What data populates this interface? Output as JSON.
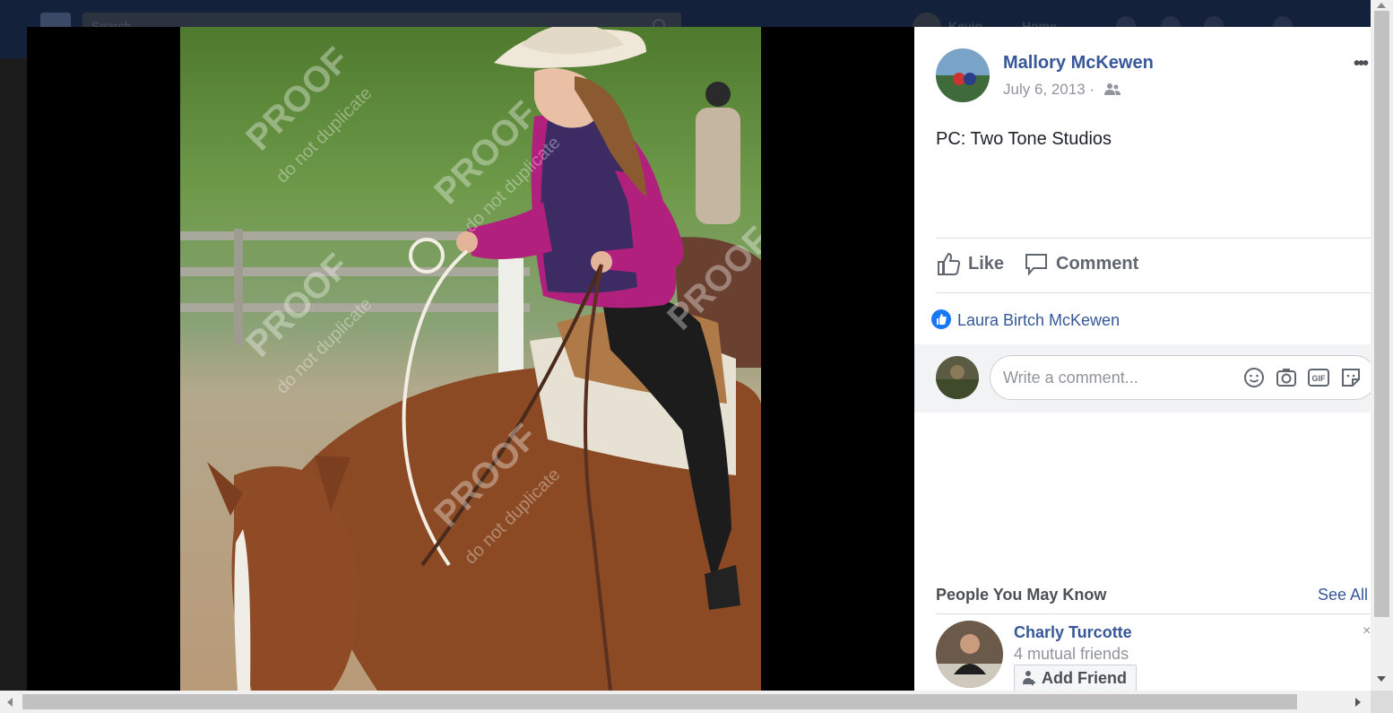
{
  "topbar": {
    "search_placeholder": "Search",
    "user_name": "Kevin",
    "home_label": "Home"
  },
  "post": {
    "author": "Mallory McKewen",
    "date": "July 6, 2013 ·",
    "audience_icon": "friends-icon",
    "more_label": "•••",
    "caption": "PC: Two Tone Studios",
    "like_label": "Like",
    "comment_label": "Comment",
    "liker": "Laura Birtch McKewen",
    "comment_placeholder": "Write a comment...",
    "gif_label": "GIF"
  },
  "photo": {
    "watermark_line1": "PROOF",
    "watermark_line2": "do not duplicate"
  },
  "pymk": {
    "title": "People You May Know",
    "see_all": "See All",
    "person_name": "Charly Turcotte",
    "mutual": "4 mutual friends",
    "add_friend": "Add Friend",
    "close_label": "×"
  },
  "colors": {
    "link_blue": "#365899",
    "like_blue": "#1877f2",
    "secondary_text": "#90949c"
  }
}
